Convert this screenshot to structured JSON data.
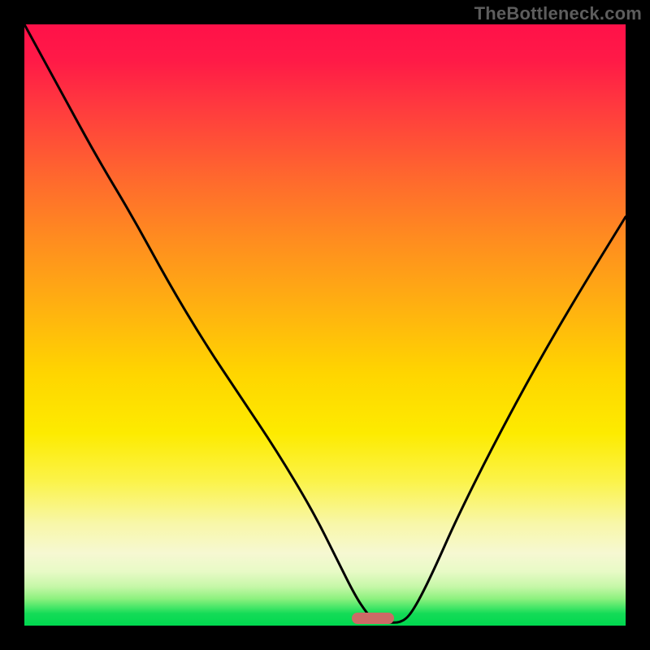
{
  "watermark": "TheBottleneck.com",
  "colors": {
    "frame": "#000000",
    "curve": "#000000",
    "marker": "#cc6a66",
    "gradient_top": "#ff1149",
    "gradient_bottom": "#00d84f"
  },
  "chart_data": {
    "type": "line",
    "title": "",
    "xlabel": "",
    "ylabel": "",
    "xlim": [
      0,
      100
    ],
    "ylim": [
      0,
      100
    ],
    "grid": false,
    "legend": false,
    "series": [
      {
        "name": "bottleneck-curve",
        "x": [
          0,
          6,
          12,
          18,
          24,
          30,
          36,
          42,
          48,
          52,
          55,
          57,
          58.5,
          60,
          63,
          65,
          68,
          72,
          78,
          85,
          92,
          100
        ],
        "y": [
          100,
          89,
          78,
          68,
          57,
          47,
          38,
          29,
          19,
          11,
          5,
          2,
          0.5,
          0.5,
          0.5,
          3,
          9,
          18,
          30,
          43,
          55,
          68
        ]
      }
    ],
    "annotations": [
      {
        "name": "optimal-marker",
        "x": 58,
        "y": 0,
        "width_pct": 7
      }
    ],
    "background_scale": {
      "type": "vertical-gradient",
      "meaning": "bottleneck severity (red=high, green=none)",
      "stops": [
        {
          "pct": 0,
          "color": "#ff1149"
        },
        {
          "pct": 50,
          "color": "#ffd500"
        },
        {
          "pct": 90,
          "color": "#f6f8d2"
        },
        {
          "pct": 100,
          "color": "#00d84f"
        }
      ]
    }
  }
}
